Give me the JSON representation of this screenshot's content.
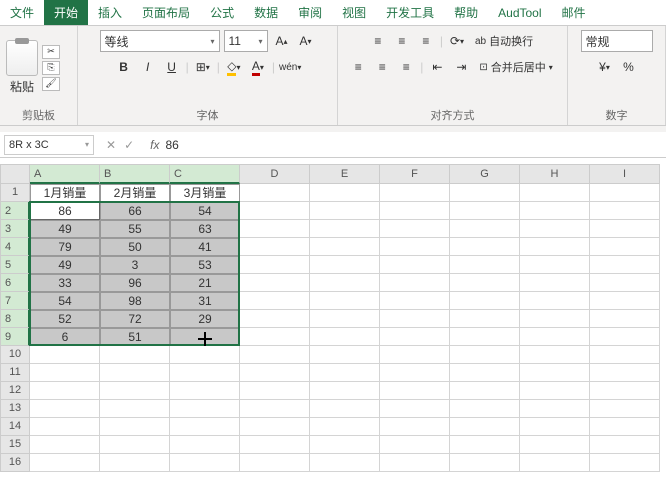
{
  "tabs": [
    "文件",
    "开始",
    "插入",
    "页面布局",
    "公式",
    "数据",
    "审阅",
    "视图",
    "开发工具",
    "帮助",
    "AudTool",
    "邮件"
  ],
  "active_tab_index": 1,
  "ribbon": {
    "clipboard": {
      "label": "剪贴板",
      "paste": "粘贴"
    },
    "font": {
      "label": "字体",
      "name": "等线",
      "size": "11",
      "bold": "B",
      "italic": "I",
      "underline": "U"
    },
    "align": {
      "label": "对齐方式",
      "wrap": "自动换行",
      "merge": "合并后居中"
    },
    "number": {
      "label": "数字",
      "format": "常规"
    }
  },
  "name_box": "8R x 3C",
  "formula_value": "86",
  "columns": [
    "A",
    "B",
    "C",
    "D",
    "E",
    "F",
    "G",
    "H",
    "I"
  ],
  "selected_cols": [
    0,
    1,
    2
  ],
  "rows": [
    1,
    2,
    3,
    4,
    5,
    6,
    7,
    8,
    9,
    10,
    11,
    12,
    13,
    14,
    15,
    16
  ],
  "selected_rows": [
    2,
    3,
    4,
    5,
    6,
    7,
    8,
    9
  ],
  "headers": [
    "1月销量",
    "2月销量",
    "3月销量"
  ],
  "data": [
    [
      86,
      66,
      54
    ],
    [
      49,
      55,
      63
    ],
    [
      79,
      50,
      41
    ],
    [
      49,
      3,
      53
    ],
    [
      33,
      96,
      21
    ],
    [
      54,
      98,
      31
    ],
    [
      52,
      72,
      29
    ],
    [
      6,
      51,
      ""
    ]
  ],
  "chart_data": {
    "type": "table",
    "title": "",
    "columns": [
      "1月销量",
      "2月销量",
      "3月销量"
    ],
    "rows": [
      [
        86,
        66,
        54
      ],
      [
        49,
        55,
        63
      ],
      [
        79,
        50,
        41
      ],
      [
        49,
        3,
        53
      ],
      [
        33,
        96,
        21
      ],
      [
        54,
        98,
        31
      ],
      [
        52,
        72,
        29
      ],
      [
        6,
        51,
        null
      ]
    ]
  }
}
